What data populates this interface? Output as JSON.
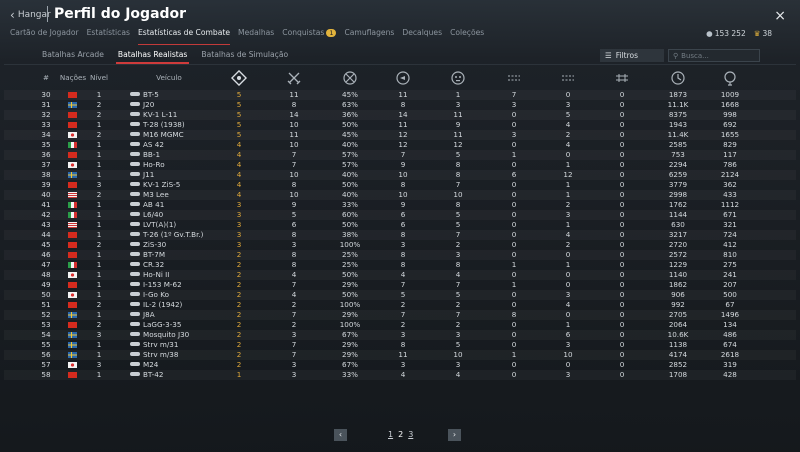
{
  "header": {
    "back_label": "Hangar",
    "title": "Perfil do Jogador",
    "close_label": "×"
  },
  "tabs": [
    {
      "label": "Cartão de Jogador"
    },
    {
      "label": "Estatísticas"
    },
    {
      "label": "Estatísticas de Combate"
    },
    {
      "label": "Medalhas"
    },
    {
      "label": "Conquistas"
    },
    {
      "label": "Camuflagens"
    },
    {
      "label": "Decalques"
    },
    {
      "label": "Coleções"
    }
  ],
  "conquistas_badge": "1",
  "currency": {
    "silver": "153 252",
    "gold": "38"
  },
  "subtabs": [
    {
      "label": "Batalhas Arcade"
    },
    {
      "label": "Batalhas Realistas"
    },
    {
      "label": "Batalhas de Simulação"
    }
  ],
  "filter_label": "Filtros",
  "search_placeholder": "Busca...",
  "columns": {
    "num": "#",
    "nation": "Nações",
    "level": "Nível",
    "vehicle": "Veículo"
  },
  "colors": {
    "accent_red": "#cf3b3b",
    "br_yellow": "#e0a93a"
  },
  "rows": [
    {
      "n": "30",
      "flag": "cn",
      "lvl": "1",
      "veh": "BT-5",
      "br": "5",
      "k": "11",
      "pct": "45%",
      "a": "11",
      "b": "1",
      "c": "7",
      "d": "0",
      "e": "0",
      "f": "1873",
      "g": "1009"
    },
    {
      "n": "31",
      "flag": "se",
      "lvl": "2",
      "veh": "J20",
      "br": "5",
      "k": "8",
      "pct": "63%",
      "a": "8",
      "b": "3",
      "c": "3",
      "d": "3",
      "e": "0",
      "f": "11.1K",
      "g": "1668"
    },
    {
      "n": "32",
      "flag": "cn",
      "lvl": "2",
      "veh": "KV-1 L-11",
      "br": "5",
      "k": "14",
      "pct": "36%",
      "a": "14",
      "b": "11",
      "c": "0",
      "d": "5",
      "e": "0",
      "f": "8375",
      "g": "998"
    },
    {
      "n": "33",
      "flag": "cn",
      "lvl": "1",
      "veh": "T-28 (1938)",
      "br": "5",
      "k": "10",
      "pct": "50%",
      "a": "11",
      "b": "9",
      "c": "0",
      "d": "4",
      "e": "0",
      "f": "1943",
      "g": "692"
    },
    {
      "n": "34",
      "flag": "jp",
      "lvl": "2",
      "veh": "M16 MGMC",
      "br": "5",
      "k": "11",
      "pct": "45%",
      "a": "12",
      "b": "11",
      "c": "3",
      "d": "2",
      "e": "0",
      "f": "11.4K",
      "g": "1655"
    },
    {
      "n": "35",
      "flag": "it",
      "lvl": "1",
      "veh": "AS 42",
      "br": "4",
      "k": "10",
      "pct": "40%",
      "a": "12",
      "b": "12",
      "c": "0",
      "d": "4",
      "e": "0",
      "f": "2585",
      "g": "829"
    },
    {
      "n": "36",
      "flag": "cn",
      "lvl": "1",
      "veh": "BB-1",
      "br": "4",
      "k": "7",
      "pct": "57%",
      "a": "7",
      "b": "5",
      "c": "1",
      "d": "0",
      "e": "0",
      "f": "753",
      "g": "117"
    },
    {
      "n": "37",
      "flag": "jp",
      "lvl": "1",
      "veh": "Ho-Ro",
      "br": "4",
      "k": "7",
      "pct": "57%",
      "a": "9",
      "b": "8",
      "c": "0",
      "d": "1",
      "e": "0",
      "f": "2294",
      "g": "786"
    },
    {
      "n": "38",
      "flag": "se",
      "lvl": "1",
      "veh": "J11",
      "br": "4",
      "k": "10",
      "pct": "40%",
      "a": "10",
      "b": "8",
      "c": "6",
      "d": "12",
      "e": "0",
      "f": "6259",
      "g": "2124"
    },
    {
      "n": "39",
      "flag": "cn",
      "lvl": "3",
      "veh": "KV-1 ZiS-5",
      "br": "4",
      "k": "8",
      "pct": "50%",
      "a": "8",
      "b": "7",
      "c": "0",
      "d": "1",
      "e": "0",
      "f": "3779",
      "g": "362"
    },
    {
      "n": "40",
      "flag": "us",
      "lvl": "2",
      "veh": "M3 Lee",
      "br": "4",
      "k": "10",
      "pct": "40%",
      "a": "10",
      "b": "10",
      "c": "0",
      "d": "1",
      "e": "0",
      "f": "2998",
      "g": "433"
    },
    {
      "n": "41",
      "flag": "it",
      "lvl": "1",
      "veh": "AB 41",
      "br": "3",
      "k": "9",
      "pct": "33%",
      "a": "9",
      "b": "8",
      "c": "0",
      "d": "2",
      "e": "0",
      "f": "1762",
      "g": "1112"
    },
    {
      "n": "42",
      "flag": "it",
      "lvl": "1",
      "veh": "L6/40",
      "br": "3",
      "k": "5",
      "pct": "60%",
      "a": "6",
      "b": "5",
      "c": "0",
      "d": "3",
      "e": "0",
      "f": "1144",
      "g": "671"
    },
    {
      "n": "43",
      "flag": "us",
      "lvl": "1",
      "veh": "LVT(A)(1)",
      "br": "3",
      "k": "6",
      "pct": "50%",
      "a": "6",
      "b": "5",
      "c": "0",
      "d": "1",
      "e": "0",
      "f": "630",
      "g": "321"
    },
    {
      "n": "44",
      "flag": "cn",
      "lvl": "1",
      "veh": "T-26 (1º Gv.T.Br.)",
      "br": "3",
      "k": "8",
      "pct": "38%",
      "a": "8",
      "b": "7",
      "c": "0",
      "d": "4",
      "e": "0",
      "f": "3217",
      "g": "724"
    },
    {
      "n": "45",
      "flag": "cn",
      "lvl": "2",
      "veh": "ZiS-30",
      "br": "3",
      "k": "3",
      "pct": "100%",
      "a": "3",
      "b": "2",
      "c": "0",
      "d": "2",
      "e": "0",
      "f": "2720",
      "g": "412"
    },
    {
      "n": "46",
      "flag": "cn",
      "lvl": "1",
      "veh": "BT-7M",
      "br": "2",
      "k": "8",
      "pct": "25%",
      "a": "8",
      "b": "3",
      "c": "0",
      "d": "0",
      "e": "0",
      "f": "2572",
      "g": "810"
    },
    {
      "n": "47",
      "flag": "it",
      "lvl": "1",
      "veh": "CR.32",
      "br": "2",
      "k": "8",
      "pct": "25%",
      "a": "8",
      "b": "8",
      "c": "1",
      "d": "1",
      "e": "0",
      "f": "1229",
      "g": "275"
    },
    {
      "n": "48",
      "flag": "jp",
      "lvl": "1",
      "veh": "Ho-Ni II",
      "br": "2",
      "k": "4",
      "pct": "50%",
      "a": "4",
      "b": "4",
      "c": "0",
      "d": "0",
      "e": "0",
      "f": "1140",
      "g": "241"
    },
    {
      "n": "49",
      "flag": "cn",
      "lvl": "1",
      "veh": "I-153 M-62",
      "br": "2",
      "k": "7",
      "pct": "29%",
      "a": "7",
      "b": "7",
      "c": "1",
      "d": "0",
      "e": "0",
      "f": "1862",
      "g": "207"
    },
    {
      "n": "50",
      "flag": "jp",
      "lvl": "1",
      "veh": "I-Go Ko",
      "br": "2",
      "k": "4",
      "pct": "50%",
      "a": "5",
      "b": "5",
      "c": "0",
      "d": "3",
      "e": "0",
      "f": "906",
      "g": "500"
    },
    {
      "n": "51",
      "flag": "cn",
      "lvl": "2",
      "veh": "IL-2 (1942)",
      "br": "2",
      "k": "2",
      "pct": "100%",
      "a": "2",
      "b": "2",
      "c": "0",
      "d": "4",
      "e": "0",
      "f": "992",
      "g": "67"
    },
    {
      "n": "52",
      "flag": "se",
      "lvl": "1",
      "veh": "J8A",
      "br": "2",
      "k": "7",
      "pct": "29%",
      "a": "7",
      "b": "7",
      "c": "8",
      "d": "0",
      "e": "0",
      "f": "2705",
      "g": "1496"
    },
    {
      "n": "53",
      "flag": "cn",
      "lvl": "2",
      "veh": "LaGG-3-35",
      "br": "2",
      "k": "2",
      "pct": "100%",
      "a": "2",
      "b": "2",
      "c": "0",
      "d": "1",
      "e": "0",
      "f": "2064",
      "g": "134"
    },
    {
      "n": "54",
      "flag": "se",
      "lvl": "3",
      "veh": "Mosquito J30",
      "br": "2",
      "k": "3",
      "pct": "67%",
      "a": "3",
      "b": "3",
      "c": "0",
      "d": "6",
      "e": "0",
      "f": "10.6K",
      "g": "486"
    },
    {
      "n": "55",
      "flag": "se",
      "lvl": "1",
      "veh": "Strv m/31",
      "br": "2",
      "k": "7",
      "pct": "29%",
      "a": "8",
      "b": "5",
      "c": "0",
      "d": "3",
      "e": "0",
      "f": "1138",
      "g": "674"
    },
    {
      "n": "56",
      "flag": "se",
      "lvl": "1",
      "veh": "Strv m/38",
      "br": "2",
      "k": "7",
      "pct": "29%",
      "a": "11",
      "b": "10",
      "c": "1",
      "d": "10",
      "e": "0",
      "f": "4174",
      "g": "2618"
    },
    {
      "n": "57",
      "flag": "jp",
      "lvl": "3",
      "veh": "M24",
      "br": "2",
      "k": "3",
      "pct": "67%",
      "a": "3",
      "b": "3",
      "c": "0",
      "d": "0",
      "e": "0",
      "f": "2852",
      "g": "319"
    },
    {
      "n": "58",
      "flag": "cn",
      "lvl": "1",
      "veh": "BT-42",
      "br": "1",
      "k": "3",
      "pct": "33%",
      "a": "4",
      "b": "4",
      "c": "0",
      "d": "3",
      "e": "0",
      "f": "1708",
      "g": "428"
    }
  ],
  "pager": {
    "prev": "‹",
    "next": "›",
    "pages": [
      "1",
      "2",
      "3"
    ],
    "current": "2"
  }
}
